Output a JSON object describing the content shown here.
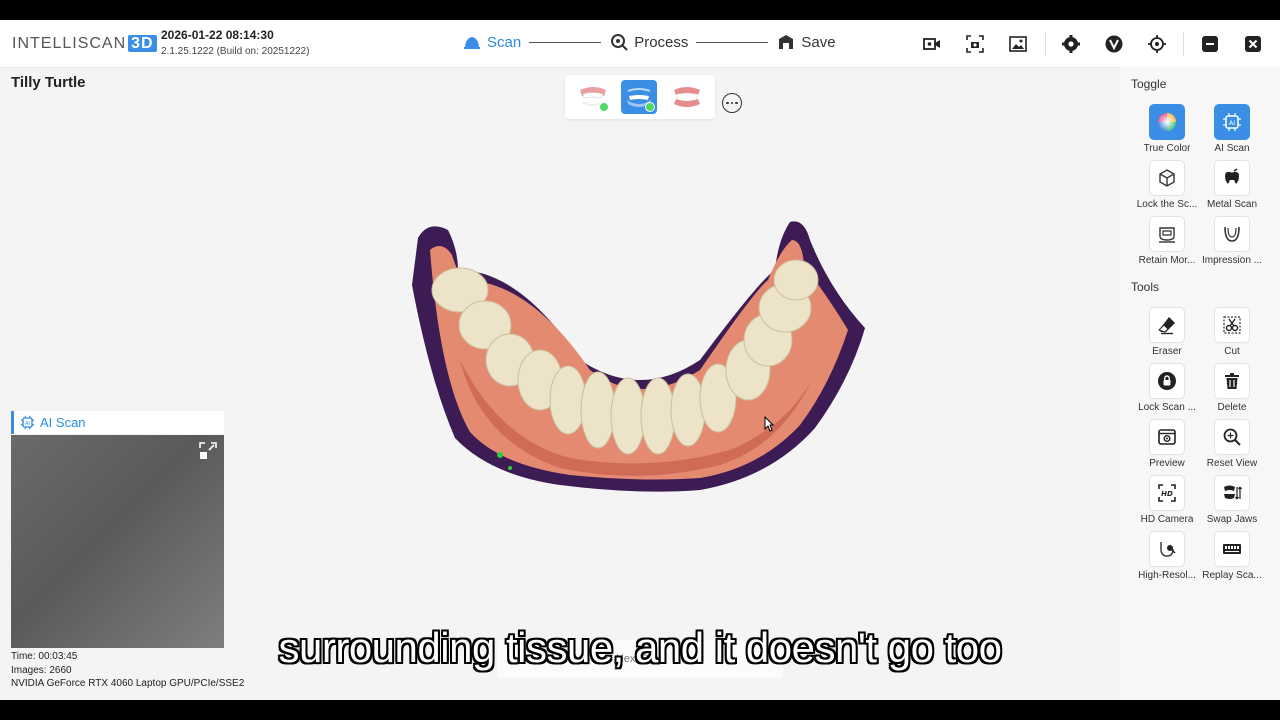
{
  "app": {
    "logo_text": "INTELLISCAN",
    "logo_badge": "3D",
    "datetime": "2026-01-22 08:14:30",
    "version": "2.1.25.1222 (Build on: 20251222)"
  },
  "workflow": {
    "steps": [
      {
        "label": "Scan",
        "icon": "scan-icon",
        "active": true
      },
      {
        "label": "Process",
        "icon": "process-icon",
        "active": false
      },
      {
        "label": "Save",
        "icon": "save-icon",
        "active": false
      }
    ]
  },
  "header_icons": [
    "record-video-icon",
    "screenshot-icon",
    "gallery-icon",
    "settings-icon",
    "vendor-logo-icon",
    "target-icon",
    "minimize-icon",
    "close-icon"
  ],
  "patient": {
    "name": "Tilly Turtle"
  },
  "jaw_selector": {
    "options": [
      {
        "icon": "upper-jaw-icon",
        "active": false,
        "status": "complete"
      },
      {
        "icon": "lower-jaw-icon",
        "active": true,
        "status": "complete"
      },
      {
        "icon": "bite-icon",
        "active": false,
        "status": "none"
      }
    ]
  },
  "toggle": {
    "title": "Toggle",
    "items": [
      {
        "label": "True Color",
        "icon": "color-wheel-icon",
        "on": true
      },
      {
        "label": "AI Scan",
        "icon": "ai-chip-icon",
        "on": true
      },
      {
        "label": "Lock the Sc...",
        "icon": "lock-cube-icon",
        "on": false
      },
      {
        "label": "Metal Scan",
        "icon": "metal-scan-icon",
        "on": false
      },
      {
        "label": "Retain Mor...",
        "icon": "retain-icon",
        "on": false
      },
      {
        "label": "Impression ...",
        "icon": "impression-icon",
        "on": false
      }
    ]
  },
  "tools": {
    "title": "Tools",
    "items": [
      {
        "label": "Eraser",
        "icon": "eraser-icon"
      },
      {
        "label": "Cut",
        "icon": "cut-icon"
      },
      {
        "label": "Lock Scan ...",
        "icon": "lock-icon"
      },
      {
        "label": "Delete",
        "icon": "trash-icon"
      },
      {
        "label": "Preview",
        "icon": "preview-icon"
      },
      {
        "label": "Reset View",
        "icon": "reset-view-icon"
      },
      {
        "label": "HD Camera",
        "icon": "hd-camera-icon"
      },
      {
        "label": "Swap Jaws",
        "icon": "swap-jaws-icon"
      },
      {
        "label": "High-Resol...",
        "icon": "high-resolution-icon"
      },
      {
        "label": "Replay Sca...",
        "icon": "replay-scan-icon"
      }
    ]
  },
  "ai_scan_panel": {
    "title": "AI Scan",
    "stats": {
      "time": "Time: 00:03:45",
      "images": "Images: 2660",
      "gpu": "NVIDIA GeForce RTX 4060 Laptop GPU/PCIe/SSE2"
    }
  },
  "hint": "Next Step",
  "subtitle": "surrounding tissue, and it doesn't go too",
  "colors": {
    "accent": "#3a8ee6",
    "status_green": "#4cd964"
  }
}
